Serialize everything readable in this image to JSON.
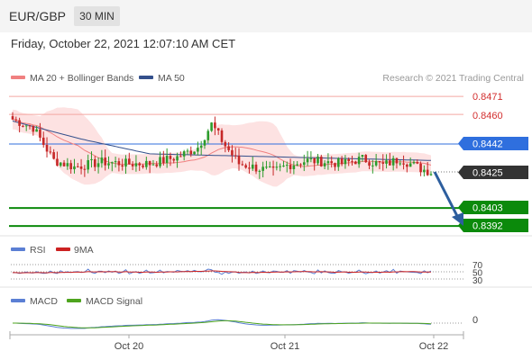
{
  "header": {
    "symbol": "EUR/GBP",
    "timeframe": "30 MIN"
  },
  "datetime": "Friday, October 22, 2021 12:07:10 AM CET",
  "colors": {
    "bb_band": "#fde2e2",
    "ma20": "#f08080",
    "ma50": "#34508c",
    "resistance": "#f4a7a2",
    "support": "#0b8a0b",
    "pivot": "#2f6fde",
    "bull": "#2c9c2c",
    "bear": "#c62828",
    "arrow": "#2d5e9e",
    "rsi": "#5b7fd4",
    "rsi_ma": "#cc2222",
    "macd": "#5b7fd4",
    "macd_signal": "#4ea41e"
  },
  "legend": {
    "ma20_label": "MA 20 + Bollinger Bands",
    "ma50_label": "MA 50",
    "credit": "Research © 2021 Trading Central"
  },
  "levels": {
    "r2": "0.8471",
    "r1": "0.8460",
    "pivot": "0.8442",
    "last": "0.8425",
    "s1": "0.8403",
    "s2": "0.8392"
  },
  "rsi_legend": {
    "rsi": "RSI",
    "ma": "9MA"
  },
  "rsi_levels": [
    "70",
    "50",
    "30"
  ],
  "macd_legend": {
    "macd": "MACD",
    "signal": "MACD Signal"
  },
  "macd_zero": "0",
  "x_axis": [
    "Oct 20",
    "Oct 21",
    "Oct 22"
  ],
  "chart_data": {
    "type": "candlestick",
    "instrument": "EUR/GBP",
    "interval": "30 MIN",
    "x_ticks": [
      "Oct 20",
      "Oct 21",
      "Oct 22"
    ],
    "ylim": [
      0.8383,
      0.8478
    ],
    "price_path": [
      {
        "i": 0,
        "p": 0.8457
      },
      {
        "i": 6,
        "p": 0.8452
      },
      {
        "i": 12,
        "p": 0.8432
      },
      {
        "i": 18,
        "p": 0.8428
      },
      {
        "i": 26,
        "p": 0.8431
      },
      {
        "i": 34,
        "p": 0.843
      },
      {
        "i": 40,
        "p": 0.843
      },
      {
        "i": 48,
        "p": 0.8434
      },
      {
        "i": 54,
        "p": 0.844
      },
      {
        "i": 58,
        "p": 0.8454
      },
      {
        "i": 62,
        "p": 0.8441
      },
      {
        "i": 66,
        "p": 0.843
      },
      {
        "i": 70,
        "p": 0.8428
      },
      {
        "i": 76,
        "p": 0.8425
      },
      {
        "i": 80,
        "p": 0.8429
      },
      {
        "i": 86,
        "p": 0.8432
      },
      {
        "i": 92,
        "p": 0.8431
      },
      {
        "i": 96,
        "p": 0.843
      },
      {
        "i": 102,
        "p": 0.8433
      },
      {
        "i": 108,
        "p": 0.8429
      },
      {
        "i": 113,
        "p": 0.8433
      },
      {
        "i": 119,
        "p": 0.8427
      },
      {
        "i": 122,
        "p": 0.8425
      }
    ],
    "ma50_path": [
      {
        "i": 0,
        "p": 0.8456
      },
      {
        "i": 20,
        "p": 0.8445
      },
      {
        "i": 40,
        "p": 0.8436
      },
      {
        "i": 60,
        "p": 0.8435
      },
      {
        "i": 80,
        "p": 0.8434
      },
      {
        "i": 100,
        "p": 0.8433
      },
      {
        "i": 122,
        "p": 0.8432
      }
    ],
    "levels": [
      {
        "label": "0.8471",
        "value": 0.8471,
        "type": "resistance"
      },
      {
        "label": "0.8460",
        "value": 0.846,
        "type": "resistance"
      },
      {
        "label": "0.8442",
        "value": 0.8442,
        "type": "pivot"
      },
      {
        "label": "0.8425",
        "value": 0.8425,
        "type": "last"
      },
      {
        "label": "0.8403",
        "value": 0.8403,
        "type": "support"
      },
      {
        "label": "0.8392",
        "value": 0.8392,
        "type": "support"
      }
    ],
    "rsi": {
      "levels": [
        70,
        50,
        30
      ]
    },
    "macd": {
      "zero_line": 0
    }
  }
}
